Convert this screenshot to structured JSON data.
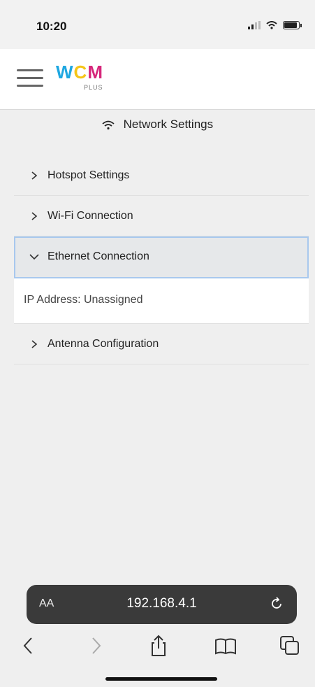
{
  "status_bar": {
    "time": "10:20"
  },
  "app": {
    "logo_text": "WCM",
    "logo_sub": "PLUS"
  },
  "page": {
    "title": "Network Settings",
    "title_icon": "wifi-icon"
  },
  "accordion": {
    "items": [
      {
        "label": "Hotspot Settings",
        "expanded": false,
        "icon": "chevron-right-icon"
      },
      {
        "label": "Wi-Fi Connection",
        "expanded": false,
        "icon": "chevron-right-icon"
      },
      {
        "label": "Ethernet Connection",
        "expanded": true,
        "icon": "chevron-down-icon",
        "panel": {
          "text": "IP Address: Unassigned"
        }
      },
      {
        "label": "Antenna Configuration",
        "expanded": false,
        "icon": "chevron-right-icon"
      }
    ]
  },
  "browser": {
    "text_size_label": "AA",
    "url": "192.168.4.1"
  },
  "colors": {
    "logo_w": "#1ea7e1",
    "logo_c": "#f5c518",
    "logo_m": "#d6267a",
    "expanded_border": "#a8c8ee",
    "url_bar_bg": "#3a3a3a"
  }
}
